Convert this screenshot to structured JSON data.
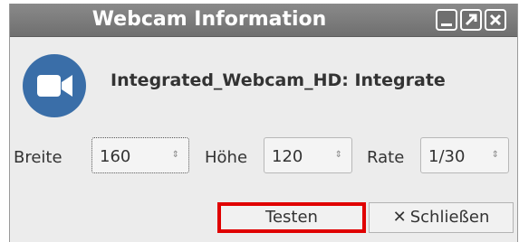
{
  "window": {
    "title": "Webcam Information",
    "controls": [
      "minimize-icon",
      "maximize-icon",
      "close-icon"
    ]
  },
  "device": {
    "icon": "camera-icon",
    "icon_color": "#3a6ea8",
    "name": "Integrated_Webcam_HD: Integrate"
  },
  "settings": {
    "breite_label": "Breite",
    "breite_value": "160",
    "hoehe_label": "Höhe",
    "hoehe_value": "120",
    "rate_label": "Rate",
    "rate_value": "1/30"
  },
  "buttons": {
    "test_label": "Testen",
    "close_label": "Schließen",
    "highlight_color": "#e00000"
  }
}
